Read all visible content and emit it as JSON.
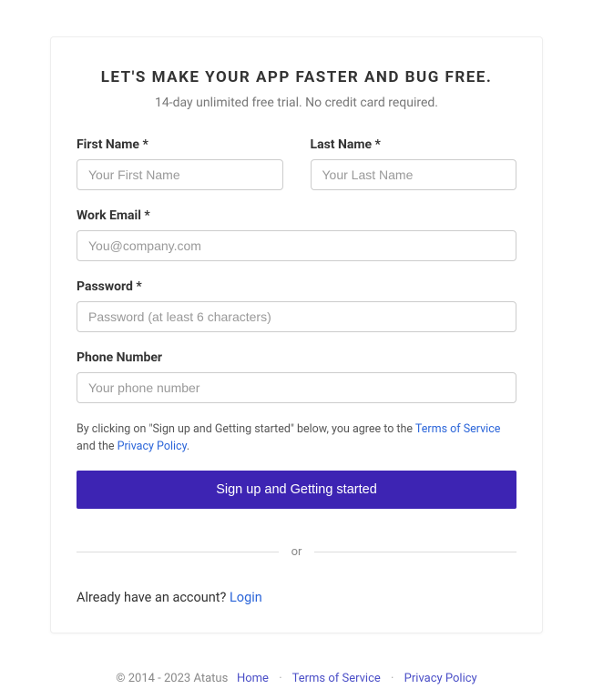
{
  "heading": "LET'S MAKE YOUR APP FASTER AND BUG FREE.",
  "subheading": "14-day unlimited free trial. No credit card required.",
  "fields": {
    "first_name": {
      "label": "First Name *",
      "placeholder": "Your First Name"
    },
    "last_name": {
      "label": "Last Name *",
      "placeholder": "Your Last Name"
    },
    "email": {
      "label": "Work Email *",
      "placeholder": "You@company.com"
    },
    "password": {
      "label": "Password *",
      "placeholder": "Password (at least 6 characters)"
    },
    "phone": {
      "label": "Phone Number",
      "placeholder": "Your phone number"
    }
  },
  "terms": {
    "prefix": "By clicking on \"Sign up and Getting started\" below, you agree to the ",
    "tos": "Terms of Service",
    "middle": " and the ",
    "privacy": "Privacy Policy",
    "suffix": "."
  },
  "submit_label": "Sign up and Getting started",
  "divider_label": "or",
  "login_prompt": {
    "text": "Already have an account?  ",
    "link": "Login"
  },
  "footer": {
    "copyright": "© 2014 - 2023 Atatus",
    "home": "Home",
    "tos": "Terms of Service",
    "privacy": "Privacy Policy",
    "sep": "·"
  }
}
